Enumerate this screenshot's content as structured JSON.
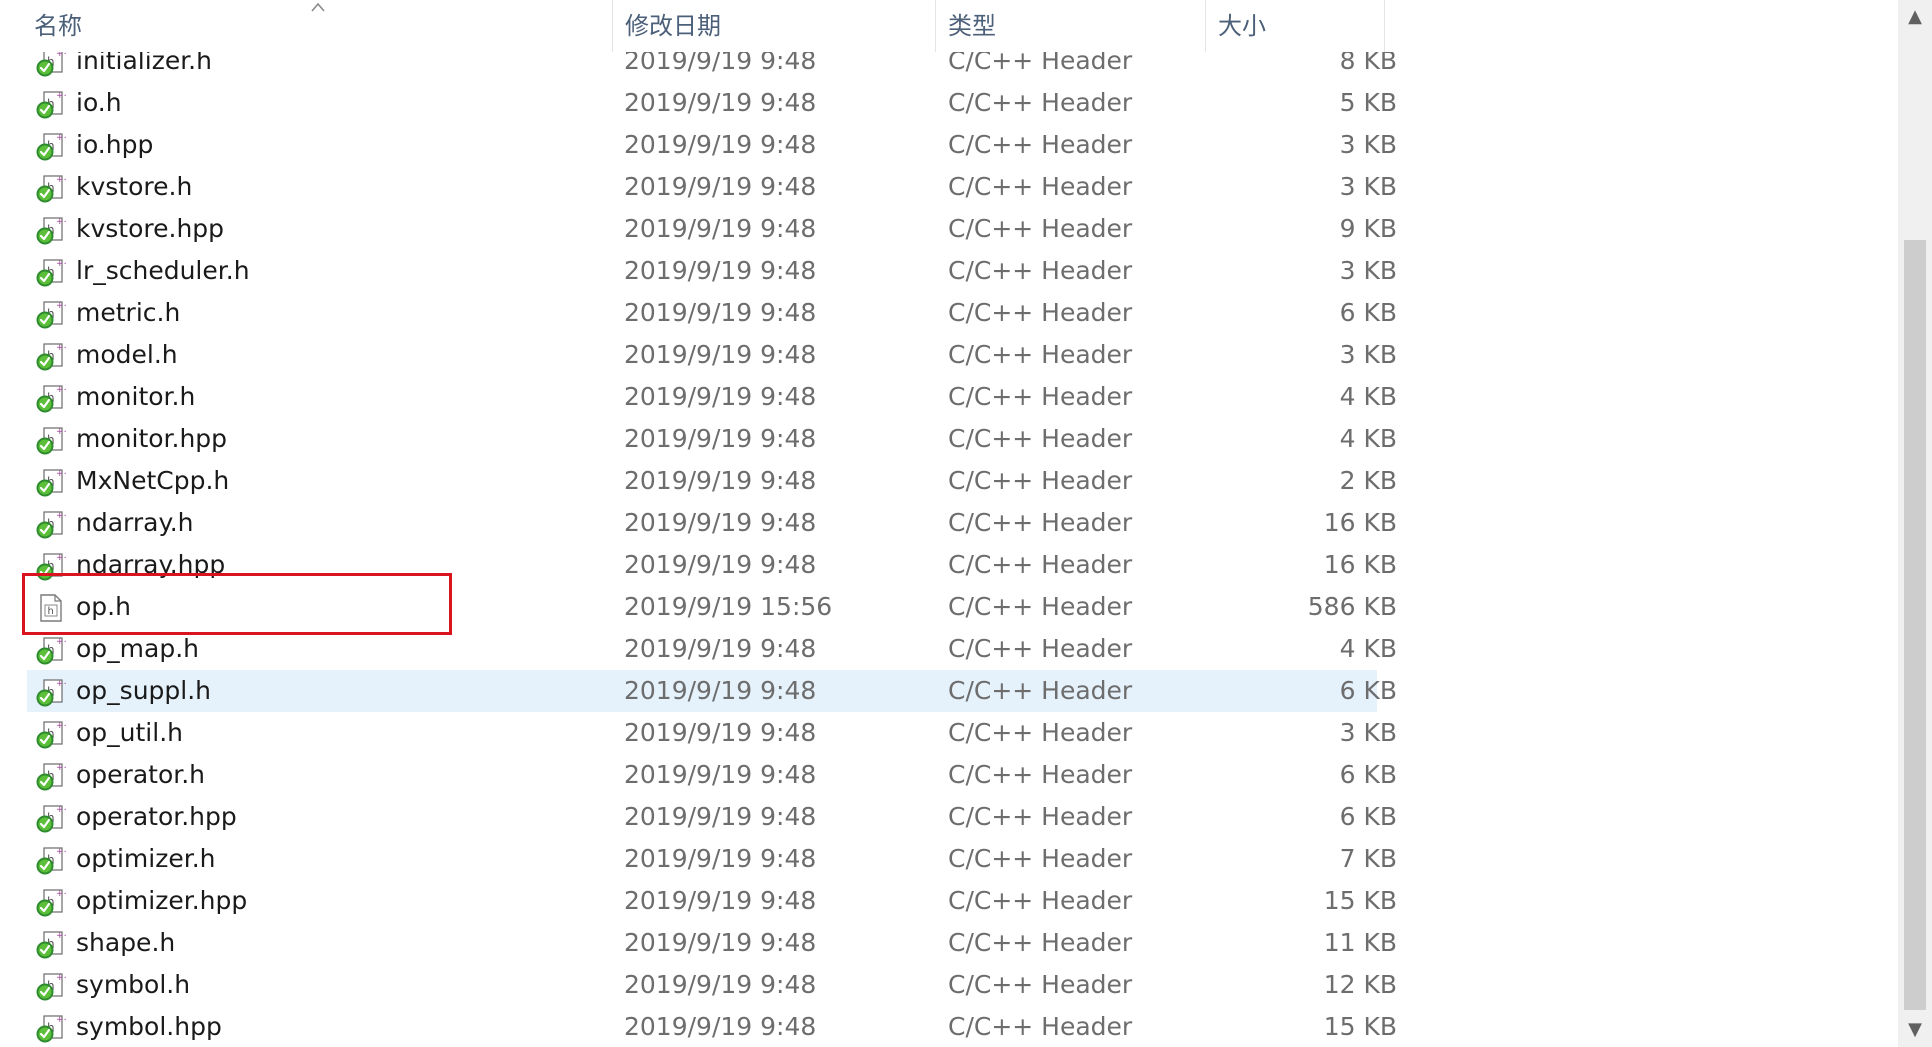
{
  "columns": {
    "name": "名称",
    "date": "修改日期",
    "type": "类型",
    "size": "大小"
  },
  "scrollbar": {
    "up": "▲",
    "down": "▼"
  },
  "files": [
    {
      "name": "initializer.h",
      "date": "2019/9/19 9:48",
      "type": "C/C++ Header",
      "size": "8 KB",
      "icon": "vs-header-icon"
    },
    {
      "name": "io.h",
      "date": "2019/9/19 9:48",
      "type": "C/C++ Header",
      "size": "5 KB",
      "icon": "vs-header-icon"
    },
    {
      "name": "io.hpp",
      "date": "2019/9/19 9:48",
      "type": "C/C++ Header",
      "size": "3 KB",
      "icon": "vs-header-icon"
    },
    {
      "name": "kvstore.h",
      "date": "2019/9/19 9:48",
      "type": "C/C++ Header",
      "size": "3 KB",
      "icon": "vs-header-icon"
    },
    {
      "name": "kvstore.hpp",
      "date": "2019/9/19 9:48",
      "type": "C/C++ Header",
      "size": "9 KB",
      "icon": "vs-header-icon"
    },
    {
      "name": "lr_scheduler.h",
      "date": "2019/9/19 9:48",
      "type": "C/C++ Header",
      "size": "3 KB",
      "icon": "vs-header-icon"
    },
    {
      "name": "metric.h",
      "date": "2019/9/19 9:48",
      "type": "C/C++ Header",
      "size": "6 KB",
      "icon": "vs-header-icon"
    },
    {
      "name": "model.h",
      "date": "2019/9/19 9:48",
      "type": "C/C++ Header",
      "size": "3 KB",
      "icon": "vs-header-icon"
    },
    {
      "name": "monitor.h",
      "date": "2019/9/19 9:48",
      "type": "C/C++ Header",
      "size": "4 KB",
      "icon": "vs-header-icon"
    },
    {
      "name": "monitor.hpp",
      "date": "2019/9/19 9:48",
      "type": "C/C++ Header",
      "size": "4 KB",
      "icon": "vs-header-icon"
    },
    {
      "name": "MxNetCpp.h",
      "date": "2019/9/19 9:48",
      "type": "C/C++ Header",
      "size": "2 KB",
      "icon": "vs-header-icon"
    },
    {
      "name": "ndarray.h",
      "date": "2019/9/19 9:48",
      "type": "C/C++ Header",
      "size": "16 KB",
      "icon": "vs-header-icon"
    },
    {
      "name": "ndarray.hpp",
      "date": "2019/9/19 9:48",
      "type": "C/C++ Header",
      "size": "16 KB",
      "icon": "vs-header-icon"
    },
    {
      "name": "op.h",
      "date": "2019/9/19 15:56",
      "type": "C/C++ Header",
      "size": "586 KB",
      "icon": "plain-header-file-icon"
    },
    {
      "name": "op_map.h",
      "date": "2019/9/19 9:48",
      "type": "C/C++ Header",
      "size": "4 KB",
      "icon": "vs-header-icon"
    },
    {
      "name": "op_suppl.h",
      "date": "2019/9/19 9:48",
      "type": "C/C++ Header",
      "size": "6 KB",
      "icon": "vs-header-icon",
      "selected": true
    },
    {
      "name": "op_util.h",
      "date": "2019/9/19 9:48",
      "type": "C/C++ Header",
      "size": "3 KB",
      "icon": "vs-header-icon"
    },
    {
      "name": "operator.h",
      "date": "2019/9/19 9:48",
      "type": "C/C++ Header",
      "size": "6 KB",
      "icon": "vs-header-icon"
    },
    {
      "name": "operator.hpp",
      "date": "2019/9/19 9:48",
      "type": "C/C++ Header",
      "size": "6 KB",
      "icon": "vs-header-icon"
    },
    {
      "name": "optimizer.h",
      "date": "2019/9/19 9:48",
      "type": "C/C++ Header",
      "size": "7 KB",
      "icon": "vs-header-icon"
    },
    {
      "name": "optimizer.hpp",
      "date": "2019/9/19 9:48",
      "type": "C/C++ Header",
      "size": "15 KB",
      "icon": "vs-header-icon"
    },
    {
      "name": "shape.h",
      "date": "2019/9/19 9:48",
      "type": "C/C++ Header",
      "size": "11 KB",
      "icon": "vs-header-icon"
    },
    {
      "name": "symbol.h",
      "date": "2019/9/19 9:48",
      "type": "C/C++ Header",
      "size": "12 KB",
      "icon": "vs-header-icon"
    },
    {
      "name": "symbol.hpp",
      "date": "2019/9/19 9:48",
      "type": "C/C++ Header",
      "size": "15 KB",
      "icon": "vs-header-icon"
    }
  ],
  "colors": {
    "header_text": "#4c607a",
    "selection_bg": "#e5f1fb",
    "highlight_border": "#d9141f"
  }
}
